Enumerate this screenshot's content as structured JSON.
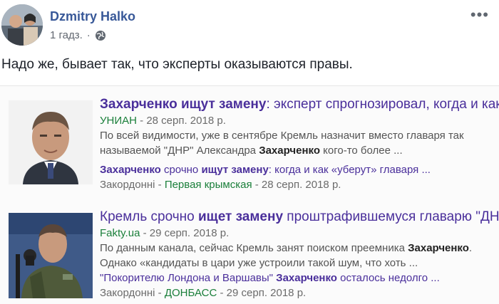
{
  "post": {
    "author": "Dzmitry Halko",
    "time": "1 гадз.",
    "dot": "·",
    "more": "•••",
    "text": "Надо же, бывает так, что эксперты оказываются правы."
  },
  "results": [
    {
      "title_bold": "Захарченко ищут замену",
      "title_rest": ": эксперт спрогнозировал, когда и как ...",
      "source": "УНИАН",
      "date": " - 28 серп. 2018 р.",
      "snippet_line1": "По всей видимости, уже в сентябре Кремль назначит вместо главаря так",
      "snippet_line2_pre": "называемой \"ДНР\" Александра ",
      "snippet_line2_bold": "Захарченко",
      "snippet_line2_post": " кого-то более ...",
      "sub_bold1": "Захарченко",
      "sub_mid": " срочно ",
      "sub_bold2": "ищут замену",
      "sub_rest": ": когда и как «уберут» главаря ...",
      "sub_src1": "Закордонні",
      "sub_sep": " - ",
      "sub_src2": "Первая крымская",
      "sub_date": " - 28 серп. 2018 р."
    },
    {
      "title_pre": "Кремль срочно ",
      "title_bold": "ищет замену",
      "title_rest": " проштрафившемуся главарю \"ДНР ...",
      "source": "Fakty.ua",
      "date": " - 29 серп. 2018 р.",
      "snippet_line1_pre": "По данным канала, сейчас Кремль занят поиском преемника ",
      "snippet_line1_bold": "Захарченко",
      "snippet_line1_post": ".",
      "snippet_line2": "Однако «кандидаты в цари уже устроили такой шум, что хоть ...",
      "sub_pre": "\"Покорителю Лондона и Варшавы\" ",
      "sub_bold": "Захарченко",
      "sub_rest": " осталось недолго ...",
      "sub_src1": "Закордонні",
      "sub_sep": " - ",
      "sub_src2": "ДОНБАСС",
      "sub_date": " - 29 серп. 2018 р."
    }
  ]
}
